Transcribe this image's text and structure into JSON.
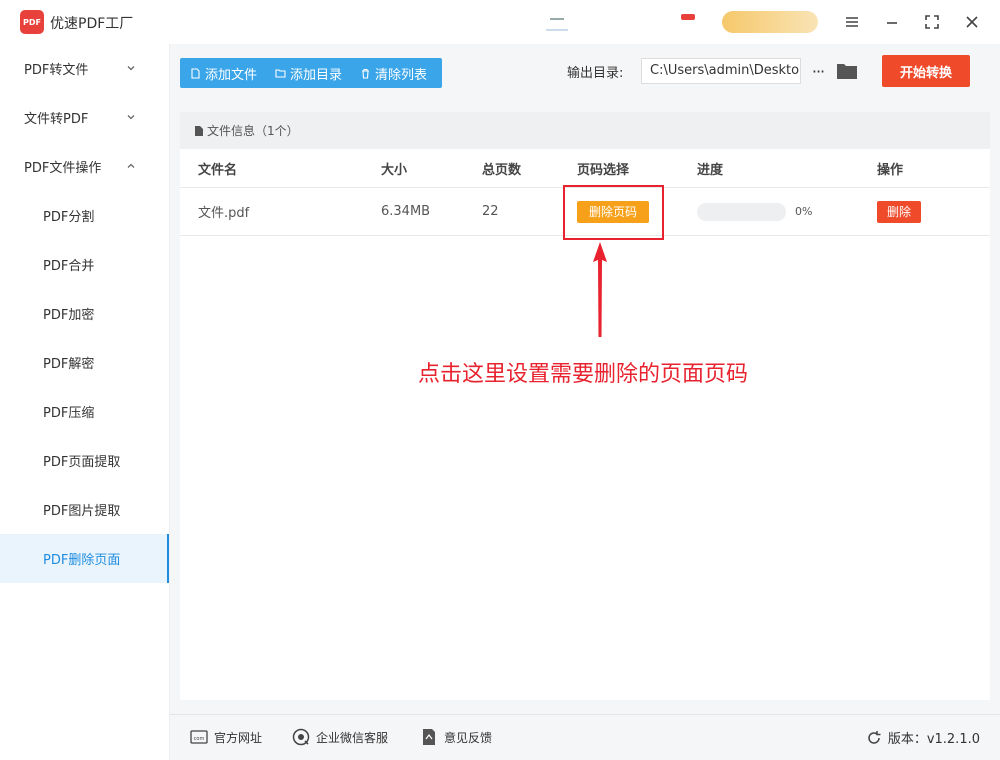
{
  "app": {
    "title": "优速PDF工厂",
    "logo_text": "PDF"
  },
  "sidebar": {
    "items": [
      {
        "label": "PDF转文件",
        "expanded": false
      },
      {
        "label": "文件转PDF",
        "expanded": false
      },
      {
        "label": "PDF文件操作",
        "expanded": true
      }
    ],
    "subitems": [
      {
        "label": "PDF分割"
      },
      {
        "label": "PDF合并"
      },
      {
        "label": "PDF加密"
      },
      {
        "label": "PDF解密"
      },
      {
        "label": "PDF压缩"
      },
      {
        "label": "PDF页面提取"
      },
      {
        "label": "PDF图片提取"
      },
      {
        "label": "PDF删除页面",
        "active": true
      }
    ]
  },
  "toolbar": {
    "add_file": "添加文件",
    "add_dir": "添加目录",
    "clear_list": "清除列表",
    "output_label": "输出目录:",
    "output_path": "C:\\Users\\admin\\Deskto",
    "more": "···",
    "start": "开始转换"
  },
  "panel": {
    "header": "文件信息（1个）",
    "columns": [
      "文件名",
      "大小",
      "总页数",
      "页码选择",
      "进度",
      "操作"
    ],
    "rows": [
      {
        "name": "文件.pdf",
        "size": "6.34MB",
        "pages": "22",
        "select_btn": "删除页码",
        "progress": 0,
        "progress_text": "0%",
        "op_btn": "删除"
      }
    ]
  },
  "annotation": {
    "text": "点击这里设置需要删除的页面页码"
  },
  "footer": {
    "website": "官方网址",
    "wechat": "企业微信客服",
    "feedback": "意见反馈",
    "version": "版本：v1.2.1.0"
  },
  "colors": {
    "primary": "#3aa5e8",
    "start": "#ef4b2b",
    "select_btn": "#f7a11a",
    "annotation": "#e8232f",
    "active_bg": "#eaf4fc"
  }
}
